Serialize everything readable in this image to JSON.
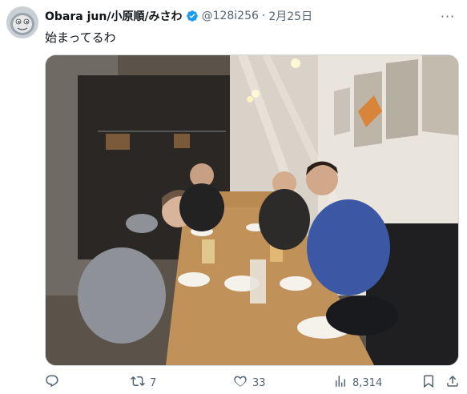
{
  "tweet": {
    "display_name": "Obara jun/小原順/みさわ",
    "handle": "@128i256",
    "separator": "·",
    "date": "2月25日",
    "text": "始まってるわ",
    "more_label": "···"
  },
  "actions": {
    "reply_count": "",
    "retweet_count": "7",
    "like_count": "33",
    "view_count": "8,314"
  },
  "icons": {
    "avatar": "avatar-cartoon-train-face",
    "verified": "verified-badge-icon",
    "more": "more-icon",
    "reply": "reply-icon",
    "retweet": "retweet-icon",
    "like": "heart-icon",
    "views": "views-chart-icon",
    "bookmark": "bookmark-icon",
    "share": "share-icon"
  },
  "colors": {
    "verified": "#1d9bf0",
    "secondary_text": "#536471",
    "primary_text": "#0f1419"
  }
}
